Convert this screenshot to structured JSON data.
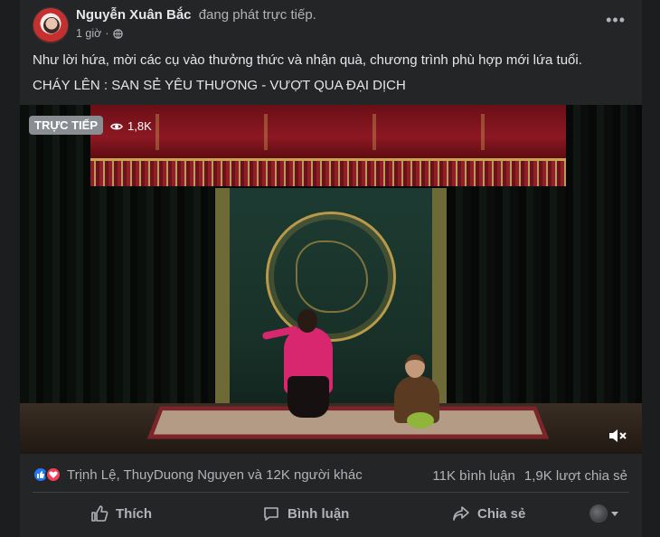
{
  "post": {
    "author": "Nguyễn Xuân Bắc",
    "status": "đang phát trực tiếp.",
    "time": "1 giờ",
    "separator": "·",
    "privacy_icon": "globe-icon",
    "more_icon": "more-options-icon",
    "more_glyph": "•••",
    "caption_line1": "Như lời hứa, mời các cụ vào thưởng thức và nhận quà, chương trình phù hợp mới lứa tuổi.",
    "caption_line2": "CHÁY LÊN : SAN SẺ YÊU THƯƠNG - VƯỢT QUA ĐẠI DỊCH"
  },
  "video": {
    "live_badge": "TRỰC TIẾP",
    "viewer_count": "1,8K",
    "viewer_icon": "eye-icon",
    "mute_icon": "speaker-muted-icon"
  },
  "engagement": {
    "reaction_icons": [
      "like-reaction-icon",
      "love-reaction-icon"
    ],
    "reactors": "Trịnh Lệ, ThuyDuong Nguyen và 12K người khác",
    "comments": "11K bình luận",
    "shares": "1,9K lượt chia sẻ"
  },
  "actions": {
    "like": "Thích",
    "comment": "Bình luận",
    "share": "Chia sẻ"
  },
  "colors": {
    "card_bg": "#242526",
    "text_primary": "#e4e6eb",
    "text_secondary": "#b0b3b8",
    "like_blue": "#2078f4",
    "love_red": "#f33e58"
  }
}
